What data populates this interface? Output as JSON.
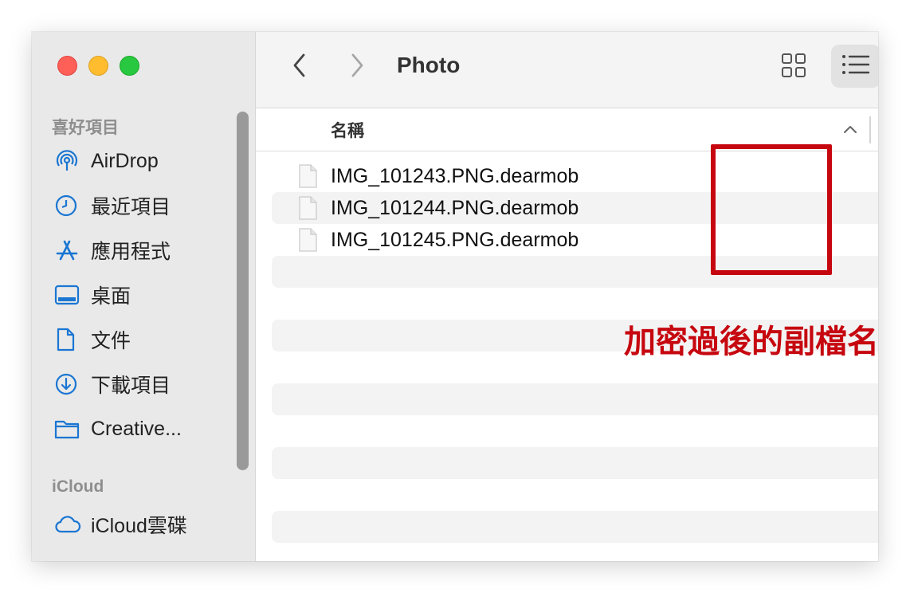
{
  "window": {
    "title": "Photo"
  },
  "sidebar": {
    "favorites_label": "喜好項目",
    "items": [
      {
        "label": "AirDrop",
        "icon": "airdrop-icon"
      },
      {
        "label": "最近項目",
        "icon": "clock-icon"
      },
      {
        "label": "應用程式",
        "icon": "apps-icon"
      },
      {
        "label": "桌面",
        "icon": "desktop-icon"
      },
      {
        "label": "文件",
        "icon": "document-icon"
      },
      {
        "label": "下載項目",
        "icon": "download-icon"
      },
      {
        "label": "Creative...",
        "icon": "folder-icon"
      }
    ],
    "icloud_label": "iCloud",
    "icloud_items": [
      {
        "label": "iCloud雲碟",
        "icon": "cloud-icon"
      }
    ]
  },
  "list": {
    "column_name": "名稱",
    "files": [
      "IMG_101243.PNG.dearmob",
      "IMG_101244.PNG.dearmob",
      "IMG_101245.PNG.dearmob"
    ]
  },
  "annotation": {
    "text": "加密過後的副檔名",
    "color": "#c6070f"
  },
  "colors": {
    "accent": "#1a76d2",
    "traffic_red": "#fe5f57",
    "traffic_yellow": "#febc2e",
    "traffic_green": "#28c840"
  }
}
